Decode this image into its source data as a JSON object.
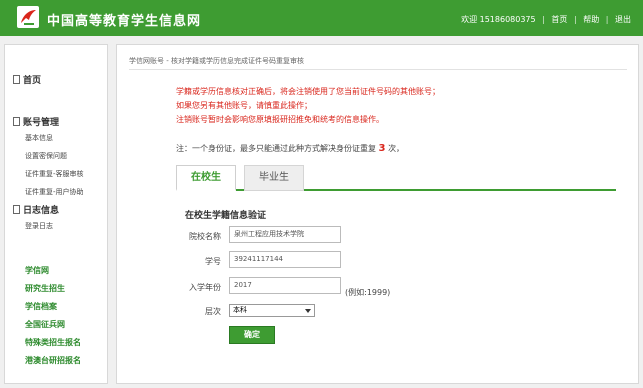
{
  "header": {
    "title": "中国高等教育学生信息网",
    "welcome": "欢迎 15186080375",
    "links": [
      "首页",
      "帮助",
      "退出"
    ],
    "separator": "|"
  },
  "sidebar": {
    "home": "首页",
    "account_title": "账号管理",
    "account_items": [
      "基本信息",
      "设置密保问题",
      "证件重复-客服审核",
      "证件重复-用户协助"
    ],
    "log_title": "日志信息",
    "log_items": [
      "登录日志"
    ],
    "links": [
      "学信网",
      "研究生招生",
      "学信档案",
      "全国征兵网",
      "特殊类招生报名",
      "港澳台研招报名"
    ]
  },
  "main": {
    "breadcrumb": "学信网账号 - 核对学籍或学历信息完成证件号码重复审核",
    "warnings": [
      "学籍或学历信息核对正确后，将会注销使用了您当前证件号码的其他账号；",
      "如果您另有其他账号，请慎重此操作；",
      "注销账号暂时会影响您原填报研招推免和统考的信息操作。"
    ],
    "note_prefix": "注：一个身份证，最多只能通过此种方式解决身份证重复",
    "note_count": "3",
    "note_suffix": "次，",
    "tabs": [
      "在校生",
      "毕业生"
    ],
    "form": {
      "title": "在校生学籍信息验证",
      "school_label": "院校名称",
      "school_value": "泉州工程应用技术学院",
      "student_id_label": "学号",
      "student_id_value": "39241117144",
      "year_label": "入学年份",
      "year_value": "2017",
      "year_hint": "(例如:1999)",
      "level_label": "层次",
      "level_value": "本科",
      "submit": "确定"
    }
  },
  "colors": {
    "brand": "#3e9c32",
    "warning": "#d9261c"
  }
}
